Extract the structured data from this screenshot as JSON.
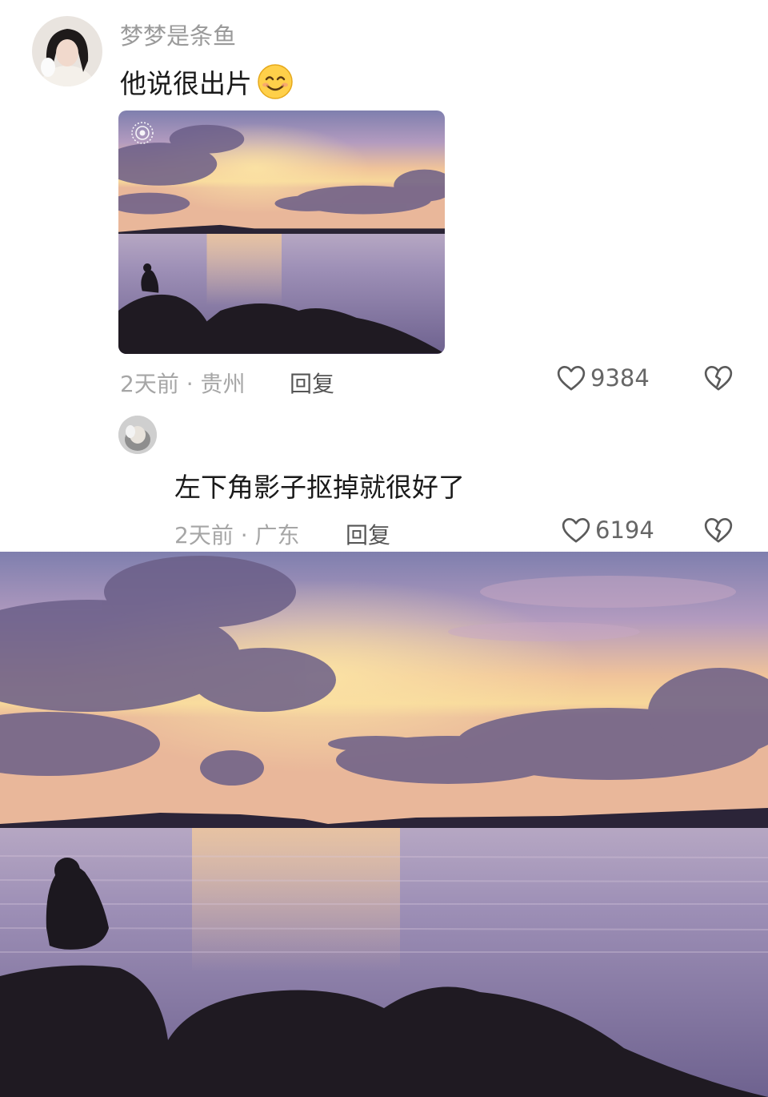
{
  "comment": {
    "username": "梦梦是条鱼",
    "text": "他说很出片",
    "emoji": "smiling-face-icon",
    "meta": "2天前 · 贵州",
    "reply_label": "回复",
    "likes": "9384"
  },
  "reply": {
    "text": "左下角影子抠掉就很好了",
    "meta": "2天前 · 广东",
    "reply_label": "回复",
    "likes": "6194"
  },
  "icons": {
    "like": "heart-outline-icon",
    "dislike": "broken-heart-icon",
    "photo_badge": "live-photo-icon"
  },
  "colors": {
    "sky_purple": "#8a7aa8",
    "sunset_orange": "#f2b27a",
    "water": "#9a8fb3"
  }
}
